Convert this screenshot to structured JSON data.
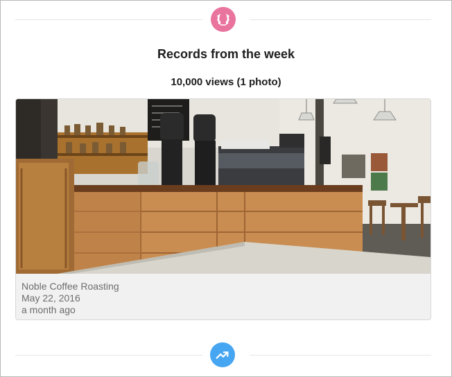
{
  "section": {
    "title": "Records from the week",
    "subtitle": "10,000 views (1 photo)",
    "top_badge_icon": "laurel-wreath-icon",
    "bottom_badge_icon": "trending-up-icon",
    "colors": {
      "top_badge": "#e9749e",
      "bottom_badge": "#47a6f2"
    }
  },
  "photo_card": {
    "image_icon": "coffee-shop-photo",
    "place": "Noble Coffee Roasting",
    "date": "May 22, 2016",
    "relative_time": "a month ago"
  }
}
